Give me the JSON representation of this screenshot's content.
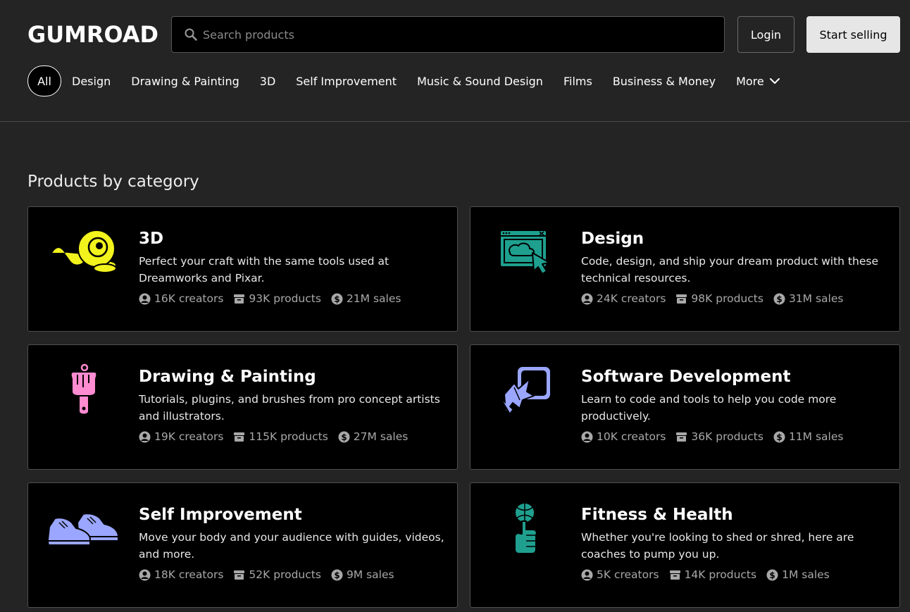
{
  "header": {
    "logo_text": "GUMROAD",
    "search": {
      "placeholder": "Search products",
      "value": ""
    },
    "login_label": "Login",
    "start_selling_label": "Start selling"
  },
  "nav": {
    "categories": [
      {
        "label": "All",
        "active": true
      },
      {
        "label": "Design"
      },
      {
        "label": "Drawing & Painting"
      },
      {
        "label": "3D"
      },
      {
        "label": "Self Improvement"
      },
      {
        "label": "Music & Sound Design"
      },
      {
        "label": "Films"
      },
      {
        "label": "Business & Money"
      },
      {
        "label": "More"
      }
    ]
  },
  "main": {
    "section_title": "Products by category",
    "cards": [
      {
        "title": "3D",
        "description": "Perfect your craft with the same tools used at Dreamworks and Pixar.",
        "creators": "16K creators",
        "products": "93K products",
        "sales": "21M sales",
        "icon": "3d-creature-icon",
        "icon_color": "#f2f21d"
      },
      {
        "title": "Design",
        "description": "Code, design, and ship your dream product with these technical resources.",
        "creators": "24K creators",
        "products": "98K products",
        "sales": "31M sales",
        "icon": "design-window-icon",
        "icon_color": "#1fa08f"
      },
      {
        "title": "Drawing & Painting",
        "description": "Tutorials, plugins, and brushes from pro concept artists and illustrators.",
        "creators": "19K creators",
        "products": "115K products",
        "sales": "27M sales",
        "icon": "paintbrush-icon",
        "icon_color": "#ff8bd0"
      },
      {
        "title": "Software Development",
        "description": "Learn to code and tools to help you code more productively.",
        "creators": "10K creators",
        "products": "36K products",
        "sales": "11M sales",
        "icon": "software-cursor-icon",
        "icon_color": "#9aa6ff"
      },
      {
        "title": "Self Improvement",
        "description": "Move your body and your audience with guides, videos, and more.",
        "creators": "18K creators",
        "products": "52K products",
        "sales": "9M sales",
        "icon": "sneakers-icon",
        "icon_color": "#9aa6ff"
      },
      {
        "title": "Fitness & Health",
        "description": "Whether you're looking to shed or shred, here are coaches to pump you up.",
        "creators": "5K creators",
        "products": "14K products",
        "sales": "1M sales",
        "icon": "basketball-hand-icon",
        "icon_color": "#1fa08f"
      }
    ]
  },
  "colors": {
    "background": "#242424",
    "card_background": "#000000",
    "border": "#4f4f4f",
    "muted_text": "#a8a8a8"
  }
}
